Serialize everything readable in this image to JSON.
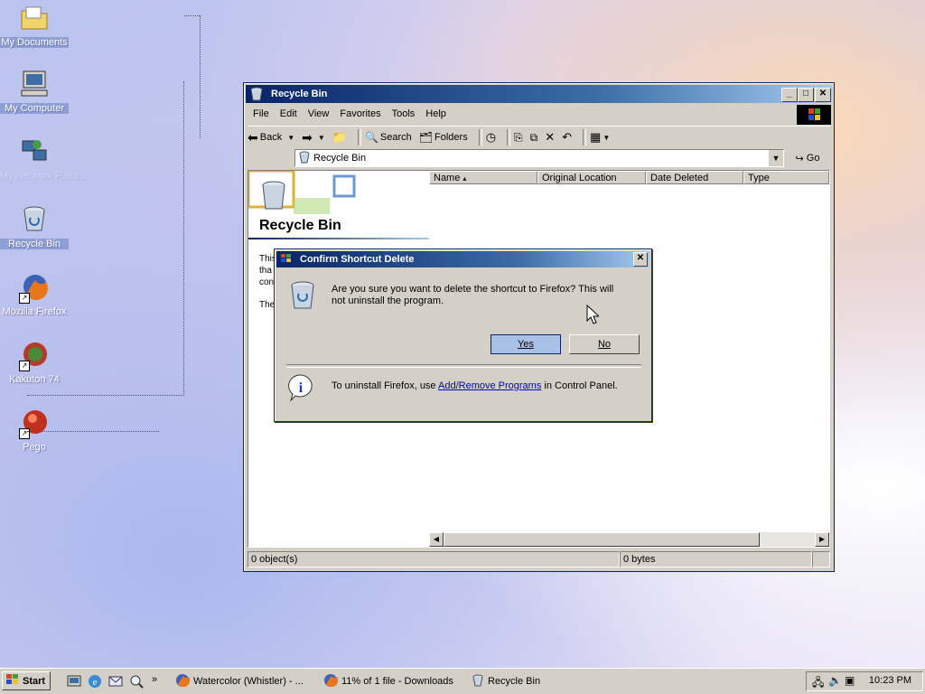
{
  "desktop": {
    "icons": [
      {
        "label": "My Documents",
        "icon": "folder-icon"
      },
      {
        "label": "My Computer",
        "icon": "computer-icon"
      },
      {
        "label": "My Network Places",
        "icon": "network-icon"
      },
      {
        "label": "Recycle Bin",
        "icon": "recycle-bin-icon"
      },
      {
        "label": "Mozilla Firefox",
        "icon": "firefox-icon"
      },
      {
        "label": "Kakuton 74",
        "icon": "app-icon"
      },
      {
        "label": "Pego",
        "icon": "app-icon"
      }
    ]
  },
  "window": {
    "title": "Recycle Bin",
    "menu": [
      "File",
      "Edit",
      "View",
      "Favorites",
      "Tools",
      "Help"
    ],
    "toolbar": {
      "back": "Back",
      "search": "Search",
      "folders": "Folders"
    },
    "address": {
      "value": "Recycle Bin",
      "go": "Go"
    },
    "left_pane": {
      "title": "Recycle Bin",
      "text_lines": [
        "This",
        "tha",
        "con",
        "The"
      ]
    },
    "columns": [
      "Name",
      "Original Location",
      "Date Deleted",
      "Type"
    ],
    "status": {
      "objects": "0 object(s)",
      "size": "0 bytes"
    }
  },
  "dialog": {
    "title": "Confirm Shortcut Delete",
    "message": "Are you sure you want to delete the shortcut to Firefox? This will not uninstall the program.",
    "yes": "Yes",
    "no": "No",
    "info_prefix": "To uninstall Firefox, use ",
    "info_link": "Add/Remove Programs",
    "info_suffix": " in Control Panel."
  },
  "taskbar": {
    "start": "Start",
    "tasks": [
      "Watercolor (Whistler) - ...",
      "11% of 1 file - Downloads",
      "Recycle Bin"
    ],
    "clock": "10:23 PM"
  }
}
